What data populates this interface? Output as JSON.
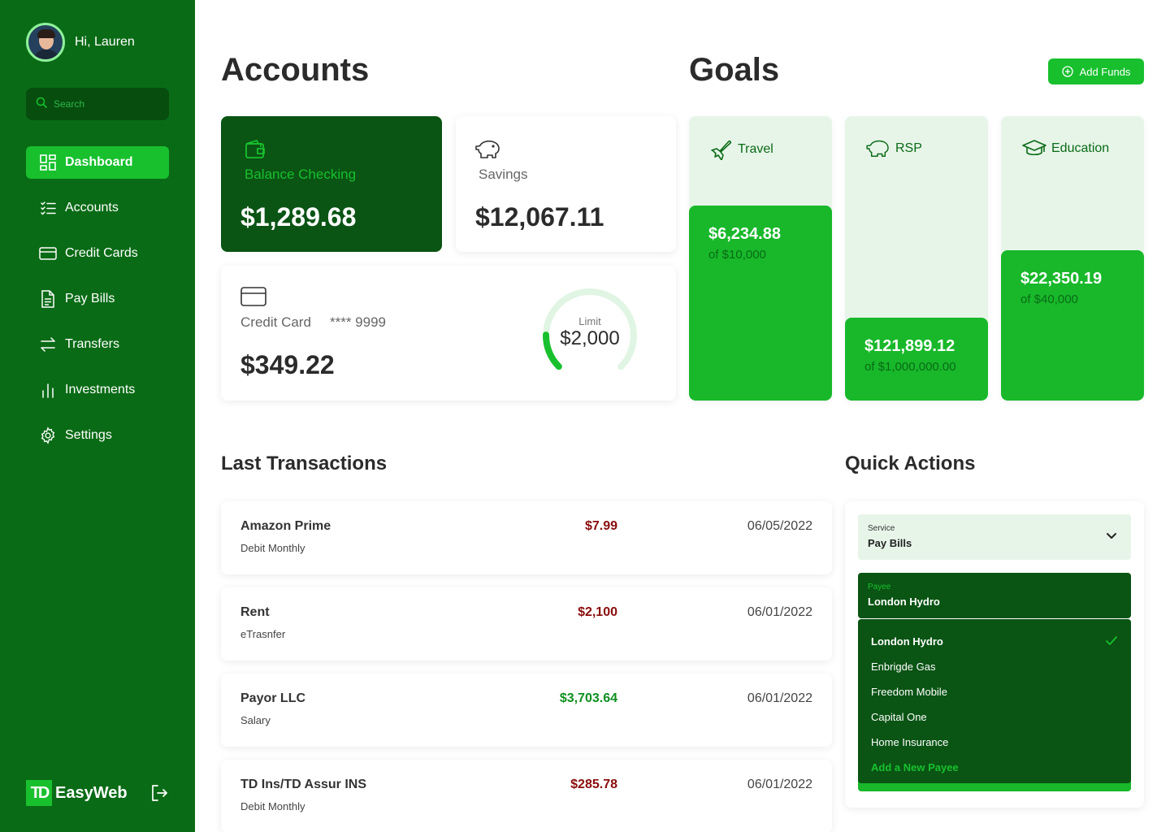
{
  "user": {
    "greeting": "Hi, Lauren"
  },
  "search": {
    "placeholder": "Search"
  },
  "nav": [
    {
      "label": "Dashboard",
      "icon": "dashboard-icon",
      "active": true
    },
    {
      "label": "Accounts",
      "icon": "list-icon"
    },
    {
      "label": "Credit Cards",
      "icon": "credit-card-icon"
    },
    {
      "label": "Pay Bills",
      "icon": "document-icon"
    },
    {
      "label": "Transfers",
      "icon": "transfer-icon"
    },
    {
      "label": "Investments",
      "icon": "bar-chart-icon"
    },
    {
      "label": "Settings",
      "icon": "gear-icon"
    }
  ],
  "brand": {
    "logo": "TD",
    "name": "EasyWeb"
  },
  "accounts": {
    "title": "Accounts",
    "checking": {
      "label": "Balance Checking",
      "amount": "$1,289.68"
    },
    "savings": {
      "label": "Savings",
      "amount": "$12,067.11"
    },
    "credit": {
      "label": "Credit Card",
      "number": "**** 9999",
      "amount": "$349.22",
      "limit_label": "Limit",
      "limit": "$2,000",
      "used_fraction": 0.17
    }
  },
  "goals": {
    "title": "Goals",
    "add_funds_label": "Add Funds",
    "items": [
      {
        "name": "Travel",
        "icon": "plane-icon",
        "amount": "$6,234.88",
        "target": "of $10,000"
      },
      {
        "name": "RSP",
        "icon": "piggy-bank-icon",
        "amount": "$121,899.12",
        "target": "of $1,000,000.00"
      },
      {
        "name": "Education",
        "icon": "graduation-cap-icon",
        "amount": "$22,350.19",
        "target": "of $40,000"
      }
    ]
  },
  "transactions": {
    "title": "Last Transactions",
    "items": [
      {
        "name": "Amazon Prime",
        "sub": "Debit Monthly",
        "amount": "$7.99",
        "date": "06/05/2022",
        "kind": "debit"
      },
      {
        "name": "Rent",
        "sub": "eTrasnfer",
        "amount": "$2,100",
        "date": "06/01/2022",
        "kind": "debit"
      },
      {
        "name": "Payor LLC",
        "sub": "Salary",
        "amount": "$3,703.64",
        "date": "06/01/2022",
        "kind": "credit"
      },
      {
        "name": "TD Ins/TD Assur INS",
        "sub": "Debit Monthly",
        "amount": "$285.78",
        "date": "06/01/2022",
        "kind": "debit"
      }
    ]
  },
  "quick_actions": {
    "title": "Quick Actions",
    "service_label": "Service",
    "service_value": "Pay Bills",
    "payee_label": "Payee",
    "payee_value": "London Hydro",
    "options": [
      "London Hydro",
      "Enbrigde Gas",
      "Freedom Mobile",
      "Capital One",
      "Home Insurance"
    ],
    "add_label": "Add a New Payee"
  },
  "colors": {
    "sidebar": "#0a6b16",
    "accent": "#18c02e",
    "dark": "#0a5414",
    "light": "#e7f5e9",
    "debit": "#8a0b0b",
    "credit": "#0e8f21"
  }
}
